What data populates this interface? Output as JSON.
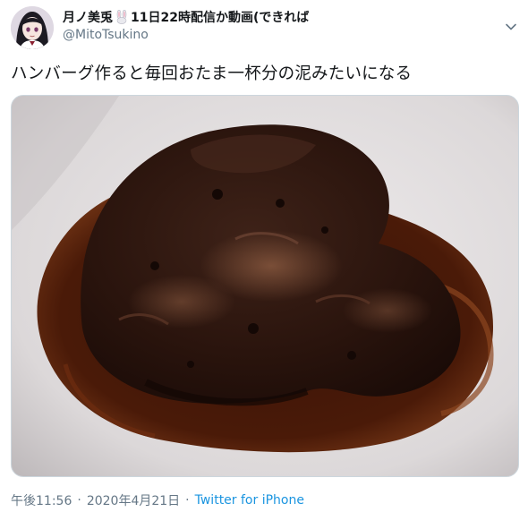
{
  "tweet": {
    "display_name": "月ノ美兎",
    "name_suffix": "11日22時配信か動画(できれば",
    "handle": "@MitoTsukino",
    "text": "ハンバーグ作ると毎回おたま一杯分の泥みたいになる",
    "time": "午後11:56",
    "separator": "·",
    "date": "2020年4月21日",
    "source": "Twitter for iPhone"
  },
  "icons": {
    "avatar": "avatar-image",
    "name_emoji": "rabbit-emoji",
    "menu": "chevron-down-icon"
  },
  "colors": {
    "text_primary": "#14171a",
    "text_secondary": "#657786",
    "link": "#1b95e0",
    "border": "#ccd6dd"
  }
}
